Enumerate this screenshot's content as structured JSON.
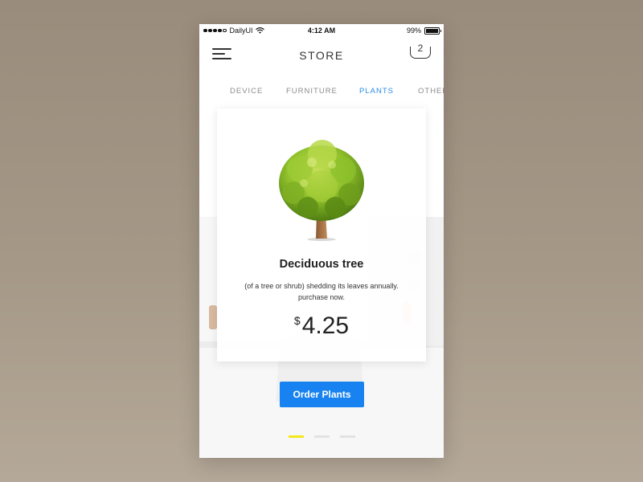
{
  "status_bar": {
    "carrier": "DailyUI",
    "time": "4:12 AM",
    "battery": "99%"
  },
  "header": {
    "title": "STORE",
    "cart_count": "2"
  },
  "tabs": [
    {
      "label": "DEVICE",
      "active": false
    },
    {
      "label": "FURNITURE",
      "active": false
    },
    {
      "label": "PLANTS",
      "active": true
    },
    {
      "label": "OTHER",
      "active": false
    }
  ],
  "product": {
    "name": "Deciduous tree",
    "description": "(of a tree or shrub) shedding its leaves annually. purchase now.",
    "currency": "$",
    "price": "4.25"
  },
  "order_button": {
    "label": "Order Plants"
  },
  "pager": {
    "pages": 3,
    "active": 0
  },
  "colors": {
    "accent": "#1883f0",
    "active_tab": "#2a8be8",
    "pager_active": "#f3e81a",
    "background": "#9a8c7c"
  }
}
